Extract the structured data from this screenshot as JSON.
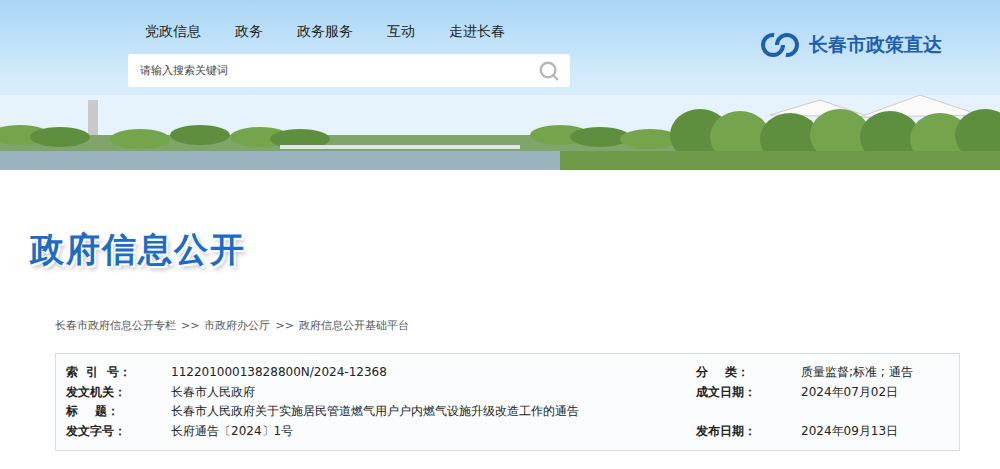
{
  "nav": [
    {
      "label": "党政信息"
    },
    {
      "label": "政务"
    },
    {
      "label": "政务服务"
    },
    {
      "label": "互动"
    },
    {
      "label": "走进长春"
    }
  ],
  "search": {
    "placeholder": "请输入搜索关键词"
  },
  "logo": {
    "text": "长春市政策直达"
  },
  "page_title": "政府信息公开",
  "breadcrumb": {
    "items": [
      "长春市政府信息公开专栏",
      "市政府办公厅",
      "政府信息公开基础平台"
    ],
    "separator": ">>"
  },
  "info_rows": [
    {
      "cells": [
        {
          "label": "索  引  号：",
          "value": "11220100013828800N/2024-12368"
        },
        {
          "label": "分    类：",
          "value": "质量监督;标准 ; 通告"
        }
      ]
    },
    {
      "cells": [
        {
          "label": "发文机关：",
          "value": "长春市人民政府"
        },
        {
          "label": "成文日期：",
          "value": "2024年07月02日"
        }
      ]
    },
    {
      "cells": [
        {
          "label": "标    题：",
          "value": "长春市人民政府关于实施居民管道燃气用户户内燃气设施升级改造工作的通告"
        }
      ]
    },
    {
      "cells": [
        {
          "label": "发文字号：",
          "value": "长府通告〔2024〕1号"
        },
        {
          "label": "发布日期：",
          "value": "2024年09月13日"
        }
      ]
    }
  ]
}
